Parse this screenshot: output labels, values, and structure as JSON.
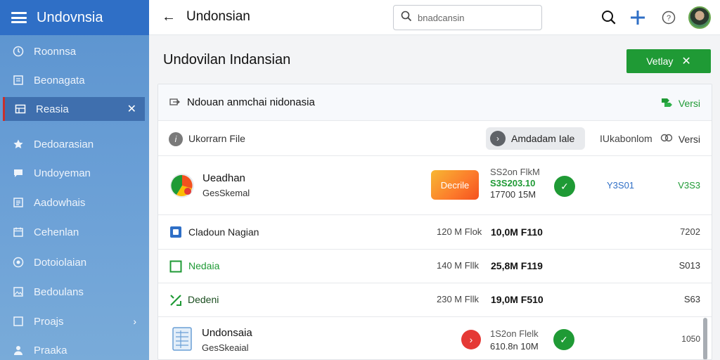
{
  "sidebar": {
    "title": "Undovnsia",
    "items": [
      {
        "label": "Roonnsa",
        "icon": "clock-icon"
      },
      {
        "label": "Beonagata",
        "icon": "document-icon"
      },
      {
        "label": "Reasia",
        "icon": "table-icon",
        "active": true
      },
      {
        "label": "Dedoarasian",
        "icon": "star-icon"
      },
      {
        "label": "Undoyeman",
        "icon": "chat-icon"
      },
      {
        "label": "Aadowhais",
        "icon": "list-icon"
      },
      {
        "label": "Cehenlan",
        "icon": "calendar-icon"
      },
      {
        "label": "Dotoiolaian",
        "icon": "target-icon"
      },
      {
        "label": "Bedoulans",
        "icon": "image-icon"
      },
      {
        "label": "Proajs",
        "icon": "checkbox-icon",
        "chevron": true
      },
      {
        "label": "Praaka",
        "icon": "person-icon"
      }
    ]
  },
  "topbar": {
    "title": "Undonsian",
    "search_placeholder": "bnadcansin"
  },
  "main": {
    "title": "Undovilan Indansian",
    "verify_label": "Vetlay"
  },
  "card": {
    "title": "Ndouan anmchai nidonasia",
    "versi_label": "Versi",
    "filter": {
      "label": "Ukorrarn File",
      "pill": "Amdadam Iale",
      "col_right1": "IUkabonlom",
      "col_right2": "Versi"
    },
    "rows": [
      {
        "name": "Ueadhan",
        "sub": "GesSkemal",
        "button": "Decrile",
        "s1": "SS2on FlkM",
        "s2": "S3S203.10",
        "s3": "17700 15M",
        "code": "Y3S01",
        "ver": "V3S3"
      },
      {
        "name": "Cladoun Nagian",
        "size": "120 M Flok",
        "value": "10,0M F110",
        "ver": "7202"
      },
      {
        "name": "Nedaia",
        "size": "140 M Fllk",
        "value": "25,8M F119",
        "ver": "S013"
      },
      {
        "name": "Dedeni",
        "size": "230 M Fllk",
        "value": "19,0M F510",
        "ver": "S63"
      },
      {
        "name": "Undonsaia",
        "sub": "GesSkeaial",
        "s1": "1S2on Flelk",
        "s3": "610.8n 10M",
        "ver": "1050"
      }
    ]
  },
  "colors": {
    "accent_blue": "#2f6fc6",
    "accent_green": "#1f9a35",
    "alert_red": "#e53935"
  }
}
